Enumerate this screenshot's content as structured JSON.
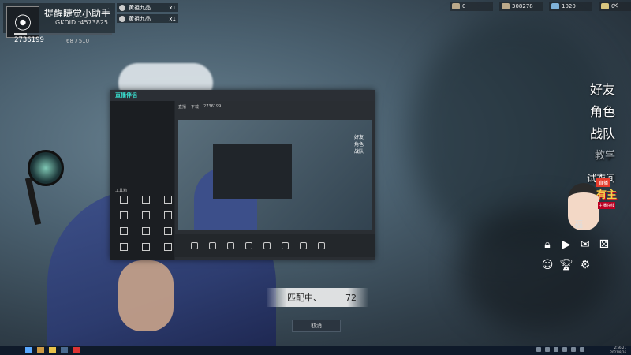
{
  "player": {
    "name": "提醒睫觉小助手",
    "id_label": "GKDID :4573825",
    "score": "2736199",
    "progress_text": "68 / 510",
    "progress_value": 0.133
  },
  "team": [
    {
      "name": "黄祖九品",
      "count": "x1"
    },
    {
      "name": "黄祖九品",
      "count": "x1"
    }
  ],
  "currencies": [
    {
      "icon": "quill-icon",
      "value": "0"
    },
    {
      "icon": "coin-icon",
      "value": "308278"
    },
    {
      "icon": "gem-icon",
      "value": "1020"
    },
    {
      "icon": "key-icon",
      "value": "0"
    }
  ],
  "right_menu": {
    "friends": "好友",
    "character": "角色",
    "team": "战队",
    "teach": "教学",
    "fitting_room": "试衣间",
    "bottom_label": "福"
  },
  "anchor_badge": {
    "tag": "直播",
    "title": "有主",
    "subtitle": "主播在线"
  },
  "overlay_window": {
    "app_name": "直播伴侣",
    "tabs": [
      "直播",
      "下载",
      "2736199"
    ],
    "tool_section_label": "工具箱",
    "preview_menu": [
      "好友",
      "角色",
      "战队"
    ]
  },
  "match": {
    "label": "匹配中、",
    "seconds": "72",
    "cancel_label": "取消"
  },
  "taskbar": {
    "clock_time": "2:56:21",
    "clock_date": "2021/8/26"
  }
}
